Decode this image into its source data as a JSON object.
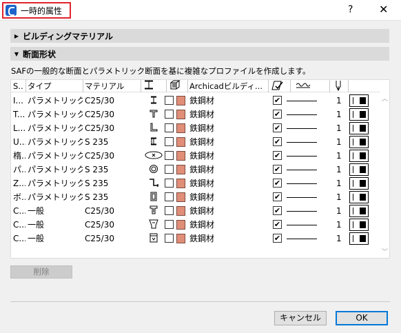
{
  "window": {
    "title": "一時的属性",
    "help": "?",
    "close": "✕"
  },
  "sections": [
    {
      "label": "ビルディングマテリアル",
      "expanded": false
    },
    {
      "label": "断面形状",
      "expanded": true
    }
  ],
  "description": "SAFの一般的な断面とパラメトリック断面を基に複雑なプロファイルを作成します。",
  "table": {
    "headers": {
      "s": "S..",
      "type": "タイプ",
      "material": "マテリアル",
      "archicad": "Archicadビルディ..."
    },
    "header_icons": [
      "profile-shape-icon",
      "fill-pattern-icon",
      "surface-edit-icon",
      "line-type-icon",
      "pen-icon"
    ],
    "rows": [
      {
        "s": "I...",
        "type": "パラメトリック",
        "material": "C25/30",
        "shape": "i-beam-icon",
        "building_material": "鉄鋼材",
        "checked": true,
        "pen": "1"
      },
      {
        "s": "T...",
        "type": "パラメトリック",
        "material": "C25/30",
        "shape": "t-section-icon",
        "building_material": "鉄鋼材",
        "checked": true,
        "pen": "1"
      },
      {
        "s": "L...",
        "type": "パラメトリック",
        "material": "C25/30",
        "shape": "l-section-icon",
        "building_material": "鉄鋼材",
        "checked": true,
        "pen": "1"
      },
      {
        "s": "U...",
        "type": "パラメトリック",
        "material": "S 235",
        "shape": "u-section-icon",
        "building_material": "鉄鋼材",
        "checked": true,
        "pen": "1"
      },
      {
        "s": "楕...",
        "type": "パラメトリック",
        "material": "C25/30",
        "shape": "ellipse-section-icon",
        "building_material": "鉄鋼材",
        "checked": true,
        "pen": "1"
      },
      {
        "s": "パ...",
        "type": "パラメトリック",
        "material": "S 235",
        "shape": "pipe-section-icon",
        "building_material": "鉄鋼材",
        "checked": true,
        "pen": "1"
      },
      {
        "s": "Z...",
        "type": "パラメトリック",
        "material": "S 235",
        "shape": "z-section-icon",
        "building_material": "鉄鋼材",
        "checked": true,
        "pen": "1"
      },
      {
        "s": "ボ...",
        "type": "パラメトリック",
        "material": "S 235",
        "shape": "box-section-icon",
        "building_material": "鉄鋼材",
        "checked": true,
        "pen": "1"
      },
      {
        "s": "C...",
        "type": "一般",
        "material": "C25/30",
        "shape": "custom-t-section-icon",
        "building_material": "鉄鋼材",
        "checked": true,
        "pen": "1"
      },
      {
        "s": "C...",
        "type": "一般",
        "material": "C25/30",
        "shape": "custom-tapered-section-icon",
        "building_material": "鉄鋼材",
        "checked": true,
        "pen": "1"
      },
      {
        "s": "C...",
        "type": "一般",
        "material": "C25/30",
        "shape": "custom-box-section-icon",
        "building_material": "鉄鋼材",
        "checked": true,
        "pen": "1"
      }
    ]
  },
  "buttons": {
    "delete": "削除",
    "cancel": "キャンセル",
    "ok": "OK"
  },
  "colors": {
    "swatch": "#e08e78",
    "title_highlight": "#e0232b",
    "ok_border": "#0078d7"
  }
}
